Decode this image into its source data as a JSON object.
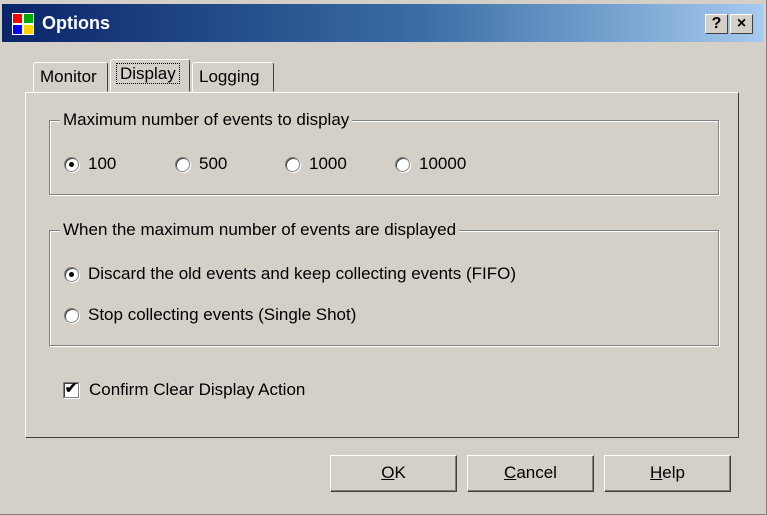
{
  "window": {
    "title": "Options",
    "help_button": "?",
    "close_button": "×"
  },
  "tabs": [
    {
      "label": "Monitor",
      "active": false
    },
    {
      "label": "Display",
      "active": true
    },
    {
      "label": "Logging",
      "active": false
    }
  ],
  "display": {
    "max_events_group": {
      "legend": "Maximum number of events to display",
      "options": [
        "100",
        "500",
        "1000",
        "10000"
      ],
      "selected": "100"
    },
    "max_reached_group": {
      "legend": "When the maximum number of events are displayed",
      "options": [
        "Discard the old events and keep collecting events (FIFO)",
        "Stop collecting events (Single Shot)"
      ],
      "selected": "Discard the old events and keep collecting events (FIFO)"
    },
    "confirm_clear": {
      "label": "Confirm Clear Display Action",
      "checked": true
    }
  },
  "buttons": {
    "ok": {
      "mnemonic": "O",
      "rest": "K"
    },
    "cancel": {
      "mnemonic": "C",
      "rest": "ancel"
    },
    "help": {
      "mnemonic": "H",
      "rest": "elp"
    }
  },
  "colors": {
    "title_gradient_start": "#0a246a",
    "title_gradient_end": "#a6caf0",
    "face": "#d4d0c8"
  }
}
